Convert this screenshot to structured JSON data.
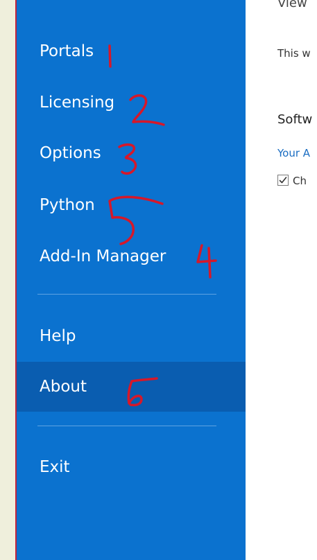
{
  "nav": {
    "items": [
      {
        "label": "Portals"
      },
      {
        "label": "Licensing"
      },
      {
        "label": "Options"
      },
      {
        "label": "Python"
      },
      {
        "label": "Add-In Manager"
      },
      {
        "label": "Help"
      },
      {
        "label": "About"
      },
      {
        "label": "Exit"
      }
    ],
    "selected": "About"
  },
  "annotations": [
    "1",
    "2",
    "3",
    "5",
    "4",
    "6"
  ],
  "content": {
    "top_heading": "View",
    "intro_text": "This w",
    "section_title": "Softw",
    "link_text": "Your A",
    "checkbox_label": "Ch",
    "checkbox_checked": true
  },
  "colors": {
    "sidebar": "#0b72cf",
    "selected_item": "#0a5db0",
    "annotation_red": "#d6182a",
    "link_blue": "#1a6dc2"
  }
}
